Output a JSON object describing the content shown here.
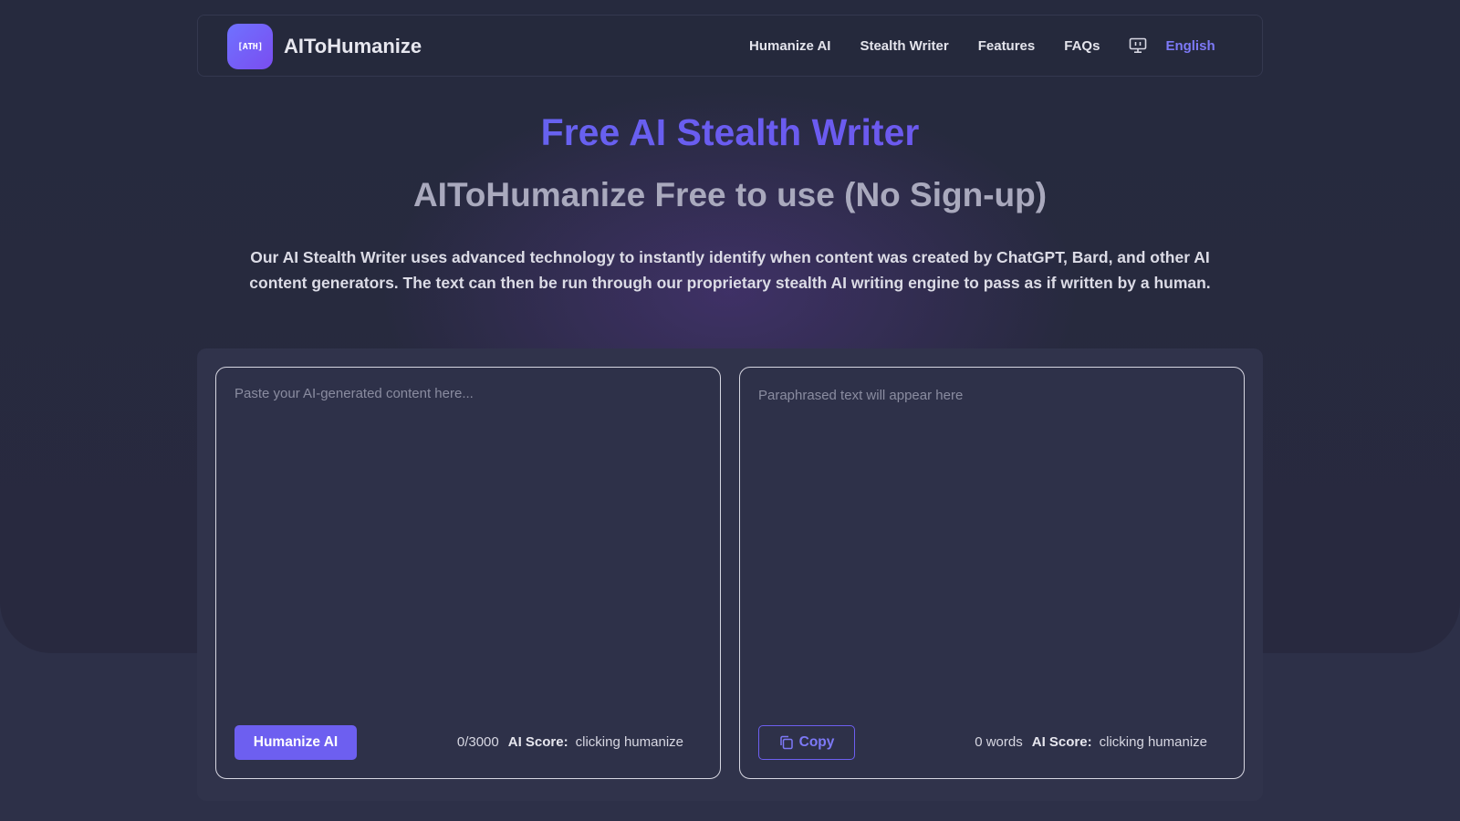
{
  "header": {
    "logo_text": "[ATH]",
    "brand": "AIToHumanize",
    "nav": [
      "Humanize AI",
      "Stealth Writer",
      "Features",
      "FAQs"
    ],
    "theme_icon": "monitor-icon",
    "language": "English"
  },
  "hero": {
    "title": "Free AI Stealth Writer",
    "subtitle": "AIToHumanize Free to use (No Sign-up)",
    "description": "Our AI Stealth Writer uses advanced technology to instantly identify when content was created by ChatGPT, Bard, and other AI content generators. The text can then be run through our proprietary stealth AI writing engine to pass as if written by a human."
  },
  "input_panel": {
    "placeholder": "Paste your AI-generated content here...",
    "value": "",
    "button": "Humanize AI",
    "char_count": "0/3000",
    "score_label": "AI Score:",
    "score_value": "clicking humanize"
  },
  "output_panel": {
    "placeholder": "Paraphrased text will appear here",
    "button": "Copy",
    "copy_icon": "copy-icon",
    "word_count": "0 words",
    "score_label": "AI Score:",
    "score_value": "clicking humanize"
  },
  "colors": {
    "accent": "#6d5ff0",
    "background": "#2d3048",
    "hero_background": "#262a3e"
  }
}
